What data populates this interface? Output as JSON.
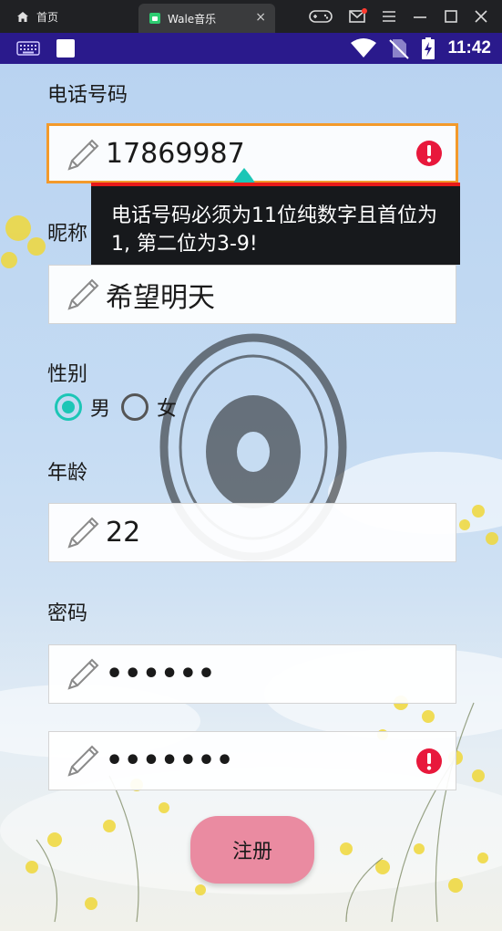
{
  "emulator": {
    "home_label": "首页",
    "tab_title": "Wale音乐",
    "tab_close": "×"
  },
  "status_bar": {
    "time": "11:42"
  },
  "form": {
    "phone": {
      "label": "电话号码",
      "value": "17869987",
      "error_message": "电话号码必须为11位纯数字且首位为1, 第二位为3-9!"
    },
    "nickname": {
      "label": "昵称",
      "value": "希望明天"
    },
    "gender": {
      "label": "性别",
      "options": [
        "男",
        "女"
      ],
      "selected": "男"
    },
    "age": {
      "label": "年龄",
      "value": "22"
    },
    "password": {
      "label": "密码",
      "value": "••••••"
    },
    "confirm_password": {
      "value": "•••••••"
    },
    "register_button": "注册"
  },
  "colors": {
    "accent_teal": "#1cc6b6",
    "error_red": "#e81a1a",
    "error_border": "#f39a2b",
    "status_bar": "#2a1a8c",
    "button_pink": "#ea8ba1"
  }
}
